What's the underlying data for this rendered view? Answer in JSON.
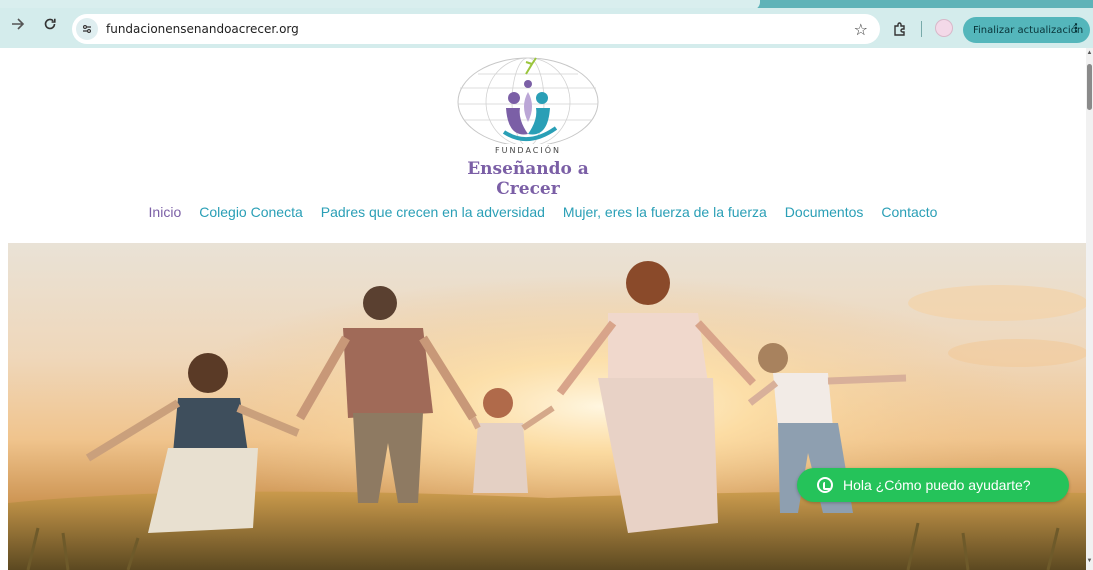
{
  "browser": {
    "url": "fundacionensenandoacrecer.org",
    "update_button_label": "Finalizar actualización",
    "icons": [
      "back-arrow-icon",
      "reload-icon",
      "site-info-icon",
      "star-icon",
      "extensions-icon",
      "profile-avatar",
      "more-menu-icon"
    ]
  },
  "site": {
    "logo_top_text": "FUNDACIÓN",
    "logo_name": "Enseñando a Crecer",
    "nav": [
      {
        "label": "Inicio",
        "active": true
      },
      {
        "label": "Colegio Conecta",
        "active": false
      },
      {
        "label": "Padres que crecen en la adversidad",
        "active": false
      },
      {
        "label": "Mujer, eres la fuerza de la fuerza",
        "active": false
      },
      {
        "label": "Documentos",
        "active": false
      },
      {
        "label": "Contacto",
        "active": false
      }
    ],
    "whatsapp_label": "Hola ¿Cómo puedo ayudarte?"
  },
  "colors": {
    "chrome": "#6fc2c6",
    "nav_link": "#2a9fb6",
    "nav_active": "#7b5fa6",
    "whatsapp": "#25c35a"
  }
}
